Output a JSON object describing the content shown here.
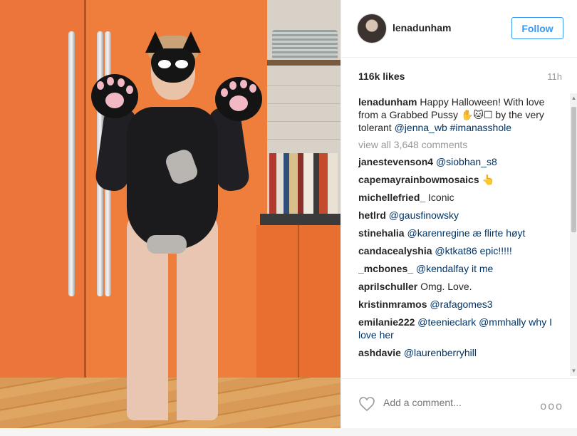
{
  "post": {
    "username": "lenadunham",
    "follow_label": "Follow",
    "likes": "116k likes",
    "time": "11h",
    "caption": {
      "user": "lenadunham",
      "text": "Happy Halloween! With love from a Grabbed Pussy ✋🐱☐ by the very tolerant ",
      "mention": "@jenna_wb",
      "hashtag": "#imanasshole"
    },
    "view_all": "view all 3,648 comments",
    "comments": [
      {
        "user": "janestevenson4",
        "text": "@siobhan_s8"
      },
      {
        "user": "capemayrainbowmosaics",
        "text": "👆"
      },
      {
        "user": "michellefried_",
        "text": "Iconic"
      },
      {
        "user": "hetlrd",
        "text": "@gausfinowsky"
      },
      {
        "user": "stinehalia",
        "text": "@karenregine æ flirte høyt"
      },
      {
        "user": "candacealyshia",
        "text": "@ktkat86 epic!!!!!"
      },
      {
        "user": "_mcbones_",
        "text": "@kendalfay it me"
      },
      {
        "user": "aprilschuller",
        "text": "Omg. Love."
      },
      {
        "user": "kristinmramos",
        "text": "@rafagomes3"
      },
      {
        "user": "emilanie222",
        "text": "@teenieclark @mmhally why I love her"
      },
      {
        "user": "ashdavie",
        "text": "@laurenberryhill"
      }
    ],
    "add_comment_placeholder": "Add a comment...",
    "more_label": "ooo"
  },
  "colors": {
    "accent": "#3897f0",
    "mention": "#003569",
    "muted": "#999999"
  },
  "icons": {
    "heart": "heart-outline-icon",
    "more": "more-options-icon",
    "scroll_up": "arrow-up-icon",
    "scroll_down": "arrow-down-icon"
  }
}
